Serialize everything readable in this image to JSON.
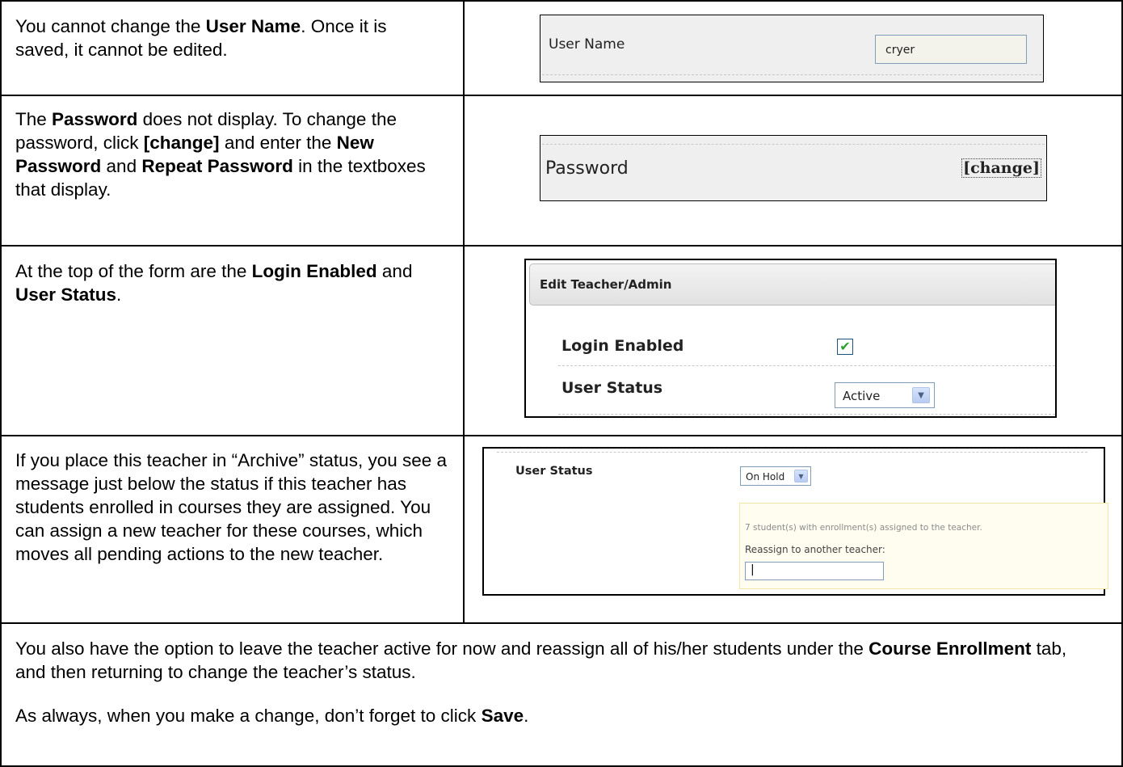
{
  "rows": [
    {
      "description": [
        {
          "t": "You cannot change the "
        },
        {
          "b": "User Name"
        },
        {
          "t": ". Once it is saved, it cannot be edited."
        }
      ],
      "shot": {
        "label": "User Name",
        "value": "cryer"
      }
    },
    {
      "description": [
        {
          "t": "The "
        },
        {
          "b": "Password"
        },
        {
          "t": " does not display. To change the password, click "
        },
        {
          "b": "[change]"
        },
        {
          "t": " and enter the "
        },
        {
          "b": "New Password"
        },
        {
          "t": " and "
        },
        {
          "b": "Repeat Password"
        },
        {
          "t": " in the textboxes that display."
        }
      ],
      "shot": {
        "label": "Password",
        "link": "[change]"
      }
    },
    {
      "description": [
        {
          "t": "At the top of the form are the "
        },
        {
          "b": "Login Enabled"
        },
        {
          "t": " and "
        },
        {
          "b": "User Status"
        },
        {
          "t": "."
        }
      ],
      "shot": {
        "title": "Edit Teacher/Admin",
        "login_label": "Login Enabled",
        "login_checked": true,
        "status_label": "User Status",
        "status_value": "Active"
      }
    },
    {
      "description": [
        {
          "t": "If you place this teacher in “Archive” status, you see a message just below the status if this teacher has students enrolled in courses they are assigned. You can assign a new teacher for these courses, which moves all pending actions to the new teacher."
        }
      ],
      "shot": {
        "status_label": "User Status",
        "status_value": "On Hold",
        "message": "7 student(s) with enrollment(s) assigned to the teacher.",
        "reassign_label": "Reassign to another teacher:",
        "input_value": "|"
      }
    }
  ],
  "footer": {
    "p1": [
      {
        "t": "You also have the option to leave the teacher active for now and reassign all of his/her students under the "
      },
      {
        "b": "Course Enrollment"
      },
      {
        "t": " tab, and then returning to change the teacher’s status."
      }
    ],
    "p2": [
      {
        "t": "As always, when you make a change, don’t forget to click "
      },
      {
        "b": "Save"
      },
      {
        "t": "."
      }
    ]
  },
  "icons": {
    "check": "checkmark-icon",
    "dropdown": "chevron-down-icon"
  },
  "colors": {
    "input_border": "#7f9db9",
    "message_bg": "#fefdf0",
    "check": "#2ca02c"
  }
}
